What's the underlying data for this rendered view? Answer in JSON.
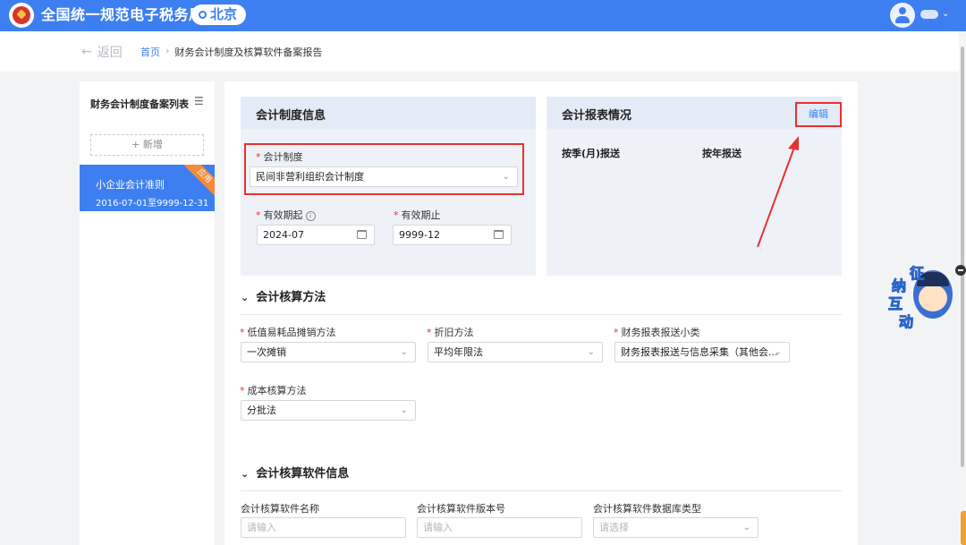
{
  "header": {
    "brand": "全国统一规范电子税务局",
    "city": "北京"
  },
  "breadcrumb": {
    "back": "返回",
    "home": "首页",
    "current": "财务会计制度及核算软件备案报告"
  },
  "sidebar": {
    "title": "财务会计制度备案列表",
    "add_label": "+ 新增",
    "items": [
      {
        "name": "小企业会计准则",
        "dates": "2016-07-01至9999-12-31",
        "badge": "应用"
      }
    ]
  },
  "accounting_system": {
    "title": "会计制度信息",
    "system_label": "会计制度",
    "system_value": "民间非营利组织会计制度",
    "start_label": "有效期起",
    "start_value": "2024-07",
    "end_label": "有效期止",
    "end_value": "9999-12"
  },
  "report": {
    "title": "会计报表情况",
    "edit_label": "编辑",
    "col_quarter": "按季(月)报送",
    "col_year": "按年报送"
  },
  "methods": {
    "title": "会计核算方法",
    "low_value_label": "低值易耗品摊销方法",
    "low_value_value": "一次摊销",
    "depreciation_label": "折旧方法",
    "depreciation_value": "平均年限法",
    "report_type_label": "财务报表报送小类",
    "report_type_value": "财务报表报送与信息采集（其他会...",
    "cost_label": "成本核算方法",
    "cost_value": "分批法"
  },
  "software": {
    "title": "会计核算软件信息",
    "name_label": "会计核算软件名称",
    "name_placeholder": "请输入",
    "version_label": "会计核算软件版本号",
    "version_placeholder": "请输入",
    "db_label": "会计核算软件数据库类型",
    "db_placeholder": "请选择"
  },
  "mascot": {
    "chars": [
      "征",
      "纳",
      "互",
      "动"
    ]
  },
  "colors": {
    "primary": "#3d7ff0",
    "highlight": "#e8322e",
    "badge": "#f08c3a"
  },
  "icons": [
    "emblem-icon",
    "location-pin-icon",
    "user-avatar-icon",
    "chevron-down-icon",
    "back-arrow-icon",
    "list-menu-icon",
    "help-circle-icon",
    "calendar-icon",
    "mascot-icon"
  ]
}
